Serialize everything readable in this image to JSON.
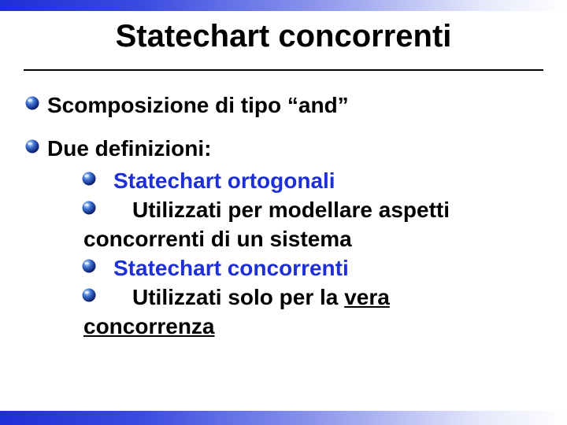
{
  "title": "Statechart concorrenti",
  "bullets": {
    "b1": "Scomposizione di tipo “and”",
    "b2": "Due definizioni:"
  },
  "sub": {
    "term1": "Statechart ortogonali",
    "desc1a": "Utilizzati per modellare aspetti",
    "desc1b": "concorrenti di un sistema",
    "term2": "Statechart concorrenti",
    "desc2a": "Utilizzati solo per la ",
    "desc2b": "vera",
    "desc2c": "concorrenza"
  }
}
